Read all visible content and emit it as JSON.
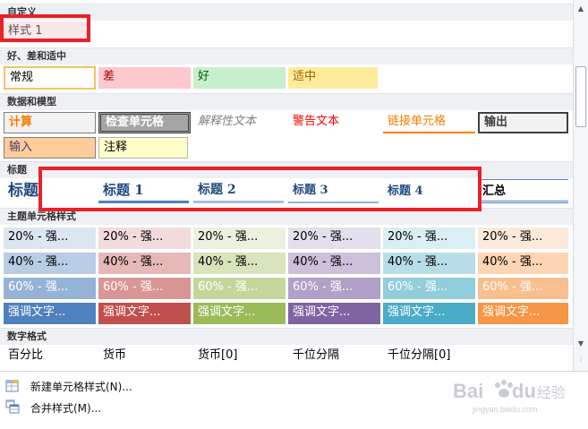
{
  "sections": {
    "custom": "自定义",
    "good_bad": "好、差和适中",
    "data_model": "数据和模型",
    "titles": "标题",
    "theme": "主题单元格样式",
    "number": "数字格式"
  },
  "custom": {
    "style1": "样式 1"
  },
  "good_bad": [
    "常规",
    "差",
    "好",
    "适中"
  ],
  "data_model": {
    "row1": [
      "计算",
      "检查单元格",
      "解释性文本",
      "警告文本",
      "链接单元格",
      "输出"
    ],
    "row2": [
      "输入",
      "注释"
    ]
  },
  "titles": [
    "标题",
    "标题 1",
    "标题 2",
    "标题 3",
    "标题 4",
    "汇总"
  ],
  "theme": {
    "row20": [
      "20% - 强...",
      "20% - 强...",
      "20% - 强...",
      "20% - 强...",
      "20% - 强...",
      "20% - 强..."
    ],
    "row40": [
      "40% - 强...",
      "40% - 强...",
      "40% - 强...",
      "40% - 强...",
      "40% - 强...",
      "40% - 强..."
    ],
    "row60": [
      "60% - 强...",
      "60% - 强...",
      "60% - 强...",
      "60% - 强...",
      "60% - 强...",
      "60% - 强..."
    ],
    "accent": [
      "强调文字...",
      "强调文字...",
      "强调文字...",
      "强调文字...",
      "强调文字...",
      "强调文字..."
    ]
  },
  "number_formats": [
    "百分比",
    "货币",
    "货币[0]",
    "千位分隔",
    "千位分隔[0]"
  ],
  "menu": {
    "new_style": "新建单元格样式(N)...",
    "merge_styles": "合并样式(M)..."
  },
  "watermark": {
    "brand": "Baidu",
    "sub": "经验",
    "url": "jingyan.baidu.com"
  },
  "colors": {
    "accent_red_box": "#e8212a",
    "bad_fill": "#ffc7ce",
    "bad_text": "#9c0006",
    "good_fill": "#c6efce",
    "good_text": "#006100",
    "neutral_fill": "#ffeb9c",
    "neutral_text": "#9c6500",
    "calc_fill": "#f2f2f2",
    "calc_text": "#fa7d00",
    "check_fill": "#a5a5a5",
    "input_fill": "#ffcc99",
    "input_text": "#3f3f76",
    "note_fill": "#ffffcc",
    "title_text": "#1f497d"
  }
}
